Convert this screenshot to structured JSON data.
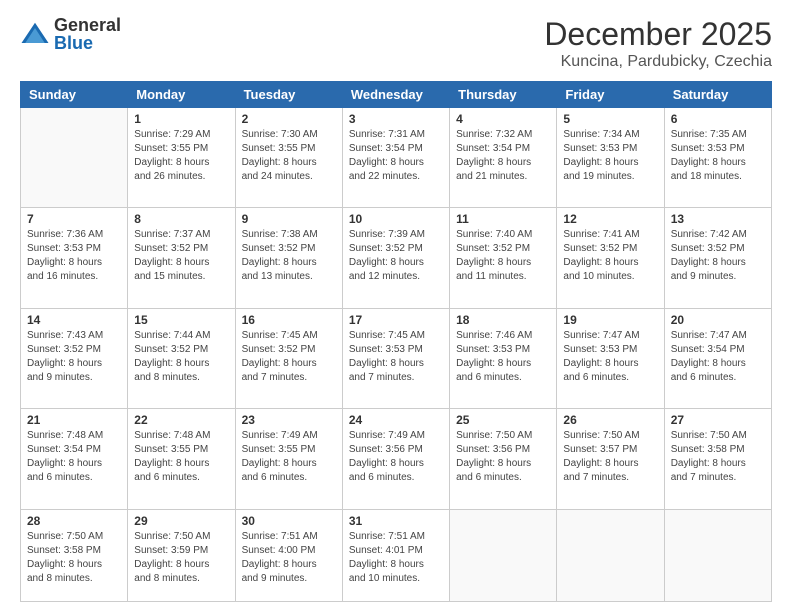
{
  "logo": {
    "general": "General",
    "blue": "Blue"
  },
  "header": {
    "month": "December 2025",
    "location": "Kuncina, Pardubicky, Czechia"
  },
  "weekdays": [
    "Sunday",
    "Monday",
    "Tuesday",
    "Wednesday",
    "Thursday",
    "Friday",
    "Saturday"
  ],
  "weeks": [
    [
      {
        "num": "",
        "info": ""
      },
      {
        "num": "1",
        "info": "Sunrise: 7:29 AM\nSunset: 3:55 PM\nDaylight: 8 hours\nand 26 minutes."
      },
      {
        "num": "2",
        "info": "Sunrise: 7:30 AM\nSunset: 3:55 PM\nDaylight: 8 hours\nand 24 minutes."
      },
      {
        "num": "3",
        "info": "Sunrise: 7:31 AM\nSunset: 3:54 PM\nDaylight: 8 hours\nand 22 minutes."
      },
      {
        "num": "4",
        "info": "Sunrise: 7:32 AM\nSunset: 3:54 PM\nDaylight: 8 hours\nand 21 minutes."
      },
      {
        "num": "5",
        "info": "Sunrise: 7:34 AM\nSunset: 3:53 PM\nDaylight: 8 hours\nand 19 minutes."
      },
      {
        "num": "6",
        "info": "Sunrise: 7:35 AM\nSunset: 3:53 PM\nDaylight: 8 hours\nand 18 minutes."
      }
    ],
    [
      {
        "num": "7",
        "info": "Sunrise: 7:36 AM\nSunset: 3:53 PM\nDaylight: 8 hours\nand 16 minutes."
      },
      {
        "num": "8",
        "info": "Sunrise: 7:37 AM\nSunset: 3:52 PM\nDaylight: 8 hours\nand 15 minutes."
      },
      {
        "num": "9",
        "info": "Sunrise: 7:38 AM\nSunset: 3:52 PM\nDaylight: 8 hours\nand 13 minutes."
      },
      {
        "num": "10",
        "info": "Sunrise: 7:39 AM\nSunset: 3:52 PM\nDaylight: 8 hours\nand 12 minutes."
      },
      {
        "num": "11",
        "info": "Sunrise: 7:40 AM\nSunset: 3:52 PM\nDaylight: 8 hours\nand 11 minutes."
      },
      {
        "num": "12",
        "info": "Sunrise: 7:41 AM\nSunset: 3:52 PM\nDaylight: 8 hours\nand 10 minutes."
      },
      {
        "num": "13",
        "info": "Sunrise: 7:42 AM\nSunset: 3:52 PM\nDaylight: 8 hours\nand 9 minutes."
      }
    ],
    [
      {
        "num": "14",
        "info": "Sunrise: 7:43 AM\nSunset: 3:52 PM\nDaylight: 8 hours\nand 9 minutes."
      },
      {
        "num": "15",
        "info": "Sunrise: 7:44 AM\nSunset: 3:52 PM\nDaylight: 8 hours\nand 8 minutes."
      },
      {
        "num": "16",
        "info": "Sunrise: 7:45 AM\nSunset: 3:52 PM\nDaylight: 8 hours\nand 7 minutes."
      },
      {
        "num": "17",
        "info": "Sunrise: 7:45 AM\nSunset: 3:53 PM\nDaylight: 8 hours\nand 7 minutes."
      },
      {
        "num": "18",
        "info": "Sunrise: 7:46 AM\nSunset: 3:53 PM\nDaylight: 8 hours\nand 6 minutes."
      },
      {
        "num": "19",
        "info": "Sunrise: 7:47 AM\nSunset: 3:53 PM\nDaylight: 8 hours\nand 6 minutes."
      },
      {
        "num": "20",
        "info": "Sunrise: 7:47 AM\nSunset: 3:54 PM\nDaylight: 8 hours\nand 6 minutes."
      }
    ],
    [
      {
        "num": "21",
        "info": "Sunrise: 7:48 AM\nSunset: 3:54 PM\nDaylight: 8 hours\nand 6 minutes."
      },
      {
        "num": "22",
        "info": "Sunrise: 7:48 AM\nSunset: 3:55 PM\nDaylight: 8 hours\nand 6 minutes."
      },
      {
        "num": "23",
        "info": "Sunrise: 7:49 AM\nSunset: 3:55 PM\nDaylight: 8 hours\nand 6 minutes."
      },
      {
        "num": "24",
        "info": "Sunrise: 7:49 AM\nSunset: 3:56 PM\nDaylight: 8 hours\nand 6 minutes."
      },
      {
        "num": "25",
        "info": "Sunrise: 7:50 AM\nSunset: 3:56 PM\nDaylight: 8 hours\nand 6 minutes."
      },
      {
        "num": "26",
        "info": "Sunrise: 7:50 AM\nSunset: 3:57 PM\nDaylight: 8 hours\nand 7 minutes."
      },
      {
        "num": "27",
        "info": "Sunrise: 7:50 AM\nSunset: 3:58 PM\nDaylight: 8 hours\nand 7 minutes."
      }
    ],
    [
      {
        "num": "28",
        "info": "Sunrise: 7:50 AM\nSunset: 3:58 PM\nDaylight: 8 hours\nand 8 minutes."
      },
      {
        "num": "29",
        "info": "Sunrise: 7:50 AM\nSunset: 3:59 PM\nDaylight: 8 hours\nand 8 minutes."
      },
      {
        "num": "30",
        "info": "Sunrise: 7:51 AM\nSunset: 4:00 PM\nDaylight: 8 hours\nand 9 minutes."
      },
      {
        "num": "31",
        "info": "Sunrise: 7:51 AM\nSunset: 4:01 PM\nDaylight: 8 hours\nand 10 minutes."
      },
      {
        "num": "",
        "info": ""
      },
      {
        "num": "",
        "info": ""
      },
      {
        "num": "",
        "info": ""
      }
    ]
  ]
}
